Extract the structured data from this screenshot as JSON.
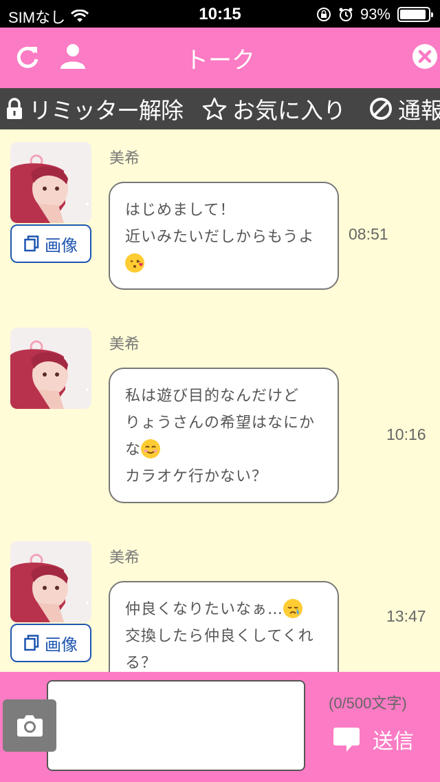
{
  "status_bar": {
    "carrier": "SIMなし",
    "time": "10:15",
    "battery": "93%",
    "battery_level": 0.93
  },
  "header": {
    "title": "トーク"
  },
  "actions": {
    "limiter": "リミッター解除",
    "favorite": "お気に入り",
    "report": "通報"
  },
  "messages": [
    {
      "sender": "美希",
      "image_label": "画像",
      "lines": [
        "はじめまして！",
        "近いみたいだしからもうよ",
        ""
      ],
      "emoji": [
        "kiss-emoji"
      ],
      "time": "08:51",
      "has_image_button": true
    },
    {
      "sender": "美希",
      "image_label": "",
      "lines": [
        "私は遊び目的なんだけど",
        "りょうさんの希望はなにか",
        "な",
        "カラオケ行かない？"
      ],
      "emoji": [
        "smile-emoji"
      ],
      "time": "10:16",
      "has_image_button": false
    },
    {
      "sender": "美希",
      "image_label": "画像",
      "lines": [
        "仲良くなりたいなぁ…",
        "交換したら仲良くしてくれ",
        "る？"
      ],
      "emoji": [
        "crying-emoji"
      ],
      "time": "13:47",
      "has_image_button": true
    }
  ],
  "composer": {
    "counter": "(0/500文字)",
    "send_label": "送信",
    "value": ""
  },
  "colors": {
    "header_pink": "#fb7bc4",
    "chat_bg": "#fffcd7",
    "action_bar": "#454545",
    "link_blue": "#1d55b0"
  }
}
